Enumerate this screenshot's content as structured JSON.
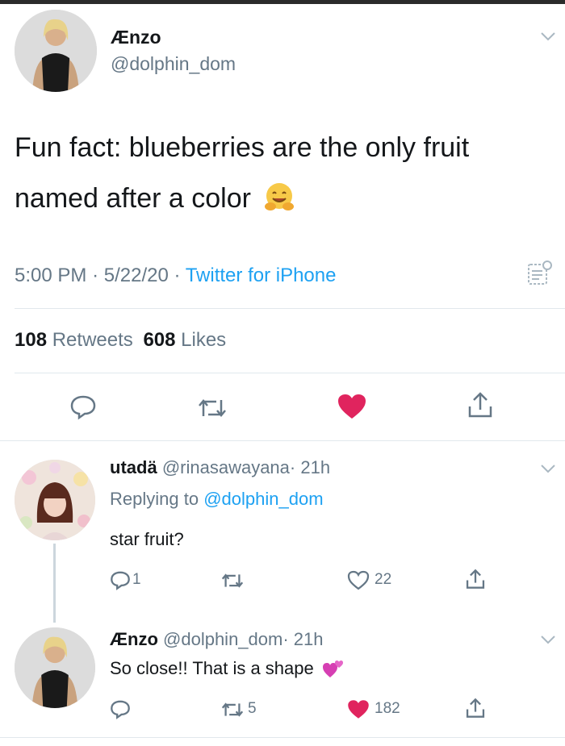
{
  "tweet": {
    "author_name": "Ænzo",
    "author_handle": "@dolphin_dom",
    "text_line1": "Fun fact: blueberries are the only fruit",
    "text_line2": "named after a color",
    "time": "5:00 PM",
    "sep1": "·",
    "date": "5/22/20",
    "sep2": "·",
    "source": "Twitter for iPhone",
    "retweets_count": "108",
    "retweets_label": "Retweets",
    "likes_count": "608",
    "likes_label": "Likes",
    "emoji": "hugging-face-emoji",
    "liked": true
  },
  "replies": [
    {
      "author_name": "utadä",
      "author_handle": "@rinasawayana",
      "sep": "·",
      "time": "21h",
      "replying_prefix": "Replying to",
      "replying_handle": "@dolphin_dom",
      "text": "star fruit?",
      "reply_count": "1",
      "retweet_count": "",
      "like_count": "22",
      "liked": false
    },
    {
      "author_name": "Ænzo",
      "author_handle": "@dolphin_dom",
      "sep": "·",
      "time": "21h",
      "text": "So close!! That is a shape",
      "emoji": "two-hearts-emoji",
      "reply_count": "",
      "retweet_count": "5",
      "like_count": "182",
      "liked": true
    }
  ],
  "colors": {
    "text": "#14171a",
    "muted": "#657786",
    "link": "#1da1f2",
    "like_red": "#e0245e",
    "divider": "#e1e8ed"
  }
}
